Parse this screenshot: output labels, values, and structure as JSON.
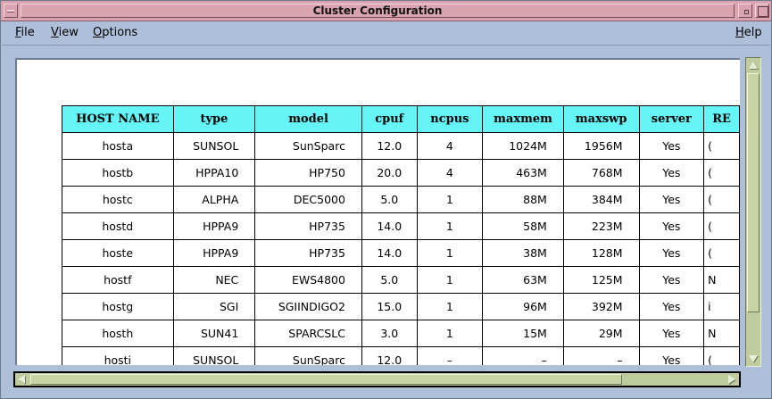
{
  "window": {
    "title": "Cluster Configuration"
  },
  "menu": {
    "file": {
      "mnemonic": "F",
      "rest": "ile"
    },
    "view": {
      "mnemonic": "V",
      "rest": "iew"
    },
    "options": {
      "mnemonic": "O",
      "rest": "ptions"
    },
    "help": {
      "mnemonic": "H",
      "rest": "elp"
    }
  },
  "table": {
    "headers": [
      "HOST NAME",
      "type",
      "model",
      "cpuf",
      "ncpus",
      "maxmem",
      "maxswp",
      "server",
      "RE"
    ],
    "rows": [
      [
        "hosta",
        "SUNSOL",
        "SunSparc",
        "12.0",
        "4",
        "1024M",
        "1956M",
        "Yes",
        "("
      ],
      [
        "hostb",
        "HPPA10",
        "HP750",
        "20.0",
        "4",
        "463M",
        "768M",
        "Yes",
        "("
      ],
      [
        "hostc",
        "ALPHA",
        "DEC5000",
        "5.0",
        "1",
        "88M",
        "384M",
        "Yes",
        "("
      ],
      [
        "hostd",
        "HPPA9",
        "HP735",
        "14.0",
        "1",
        "58M",
        "223M",
        "Yes",
        "("
      ],
      [
        "hoste",
        "HPPA9",
        "HP735",
        "14.0",
        "1",
        "38M",
        "128M",
        "Yes",
        "("
      ],
      [
        "hostf",
        "NEC",
        "EWS4800",
        "5.0",
        "1",
        "63M",
        "125M",
        "Yes",
        "N"
      ],
      [
        "hostg",
        "SGI",
        "SGIINDIGO2",
        "15.0",
        "1",
        "96M",
        "392M",
        "Yes",
        "i"
      ],
      [
        "hosth",
        "SUN41",
        "SPARCSLC",
        "3.0",
        "1",
        "15M",
        "29M",
        "Yes",
        "N"
      ],
      [
        "hosti",
        "SUNSOL",
        "SunSparc",
        "12.0",
        "–",
        "–",
        "–",
        "Yes",
        "("
      ]
    ]
  },
  "colors": {
    "titlebar": "#d9a4b0",
    "chrome": "#aebfd9",
    "table_header": "#66f5f7",
    "scrollbar": "#bfcc9e"
  }
}
